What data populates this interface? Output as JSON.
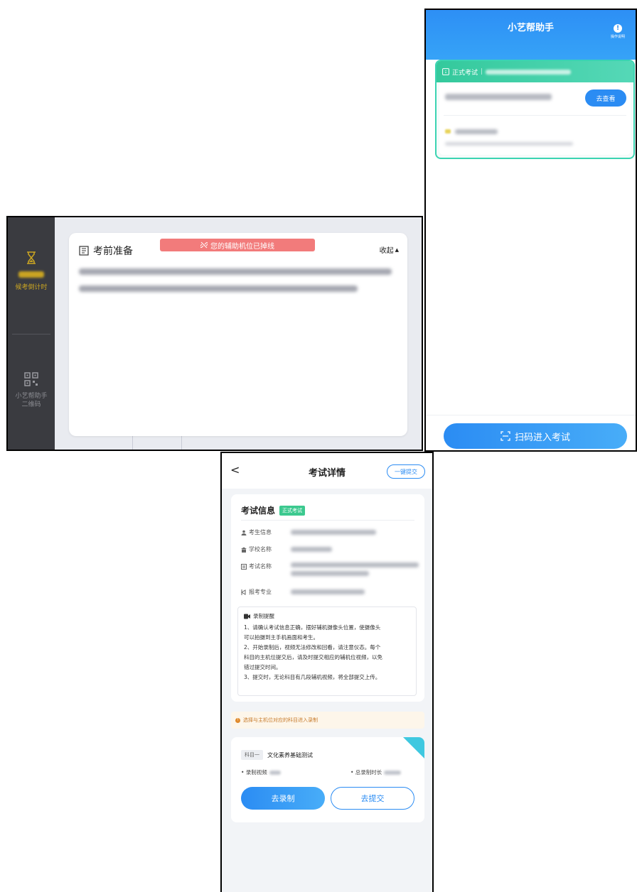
{
  "pc": {
    "sidebar_timer_label": "候考倒计时",
    "sidebar_qr_label_1": "小艺帮助手",
    "sidebar_qr_label_2": "二维码",
    "card_title": "考前准备",
    "collapse_label": "收起",
    "banner_text": "您的辅助机位已掉线"
  },
  "phone": {
    "title": "小艺帮助手",
    "help_label": "操作说明",
    "exam_tag": "正式考试",
    "go_view_label": "去查看",
    "scan_label": "扫码进入考试"
  },
  "detail": {
    "title": "考试详情",
    "submit_all_label": "一键提交",
    "info_title": "考试信息",
    "info_tag": "正式考试",
    "fields": [
      {
        "label": "考生信息"
      },
      {
        "label": "学校名称"
      },
      {
        "label": "考试名称"
      },
      {
        "label": "报考专业"
      }
    ],
    "remind_title": "录制提醒",
    "remind_lines": [
      "1、请确认考试信息正确，摆好辅机摄像头位置，使摄像头",
      "可以拍摄到主手机画面和考生。",
      "2、开始录制后，视频无法修改和回看，请注意仪态。每个",
      "科目的主机位提交后，请及时提交相应的辅机位视频，以免",
      "错过提交时间。",
      "3、提交时，无论科目有几段辅机视频，将全部提交上传。"
    ],
    "notice": "选择与主机位对应的科目进入录制",
    "subject_tag": "科目一",
    "subject_name": "文化素养基础测试",
    "record_video_label": "• 录制视频",
    "total_time_label": "• 总录制时长",
    "record_button": "去录制",
    "submit_button": "去提交"
  },
  "colors": {
    "primary_blue": "#2b8cf3",
    "green": "#3cc98f",
    "alert_red": "#f27b7b",
    "sidebar_dark": "#3a3b40",
    "timer_gold": "#c9a422"
  },
  "icons": [
    "hourglass-icon",
    "qr-code-icon",
    "document-icon",
    "link-broken-icon",
    "info-icon",
    "scan-icon",
    "back-chevron-icon",
    "user-icon",
    "school-icon",
    "exam-icon",
    "major-icon",
    "video-icon",
    "warning-icon"
  ]
}
